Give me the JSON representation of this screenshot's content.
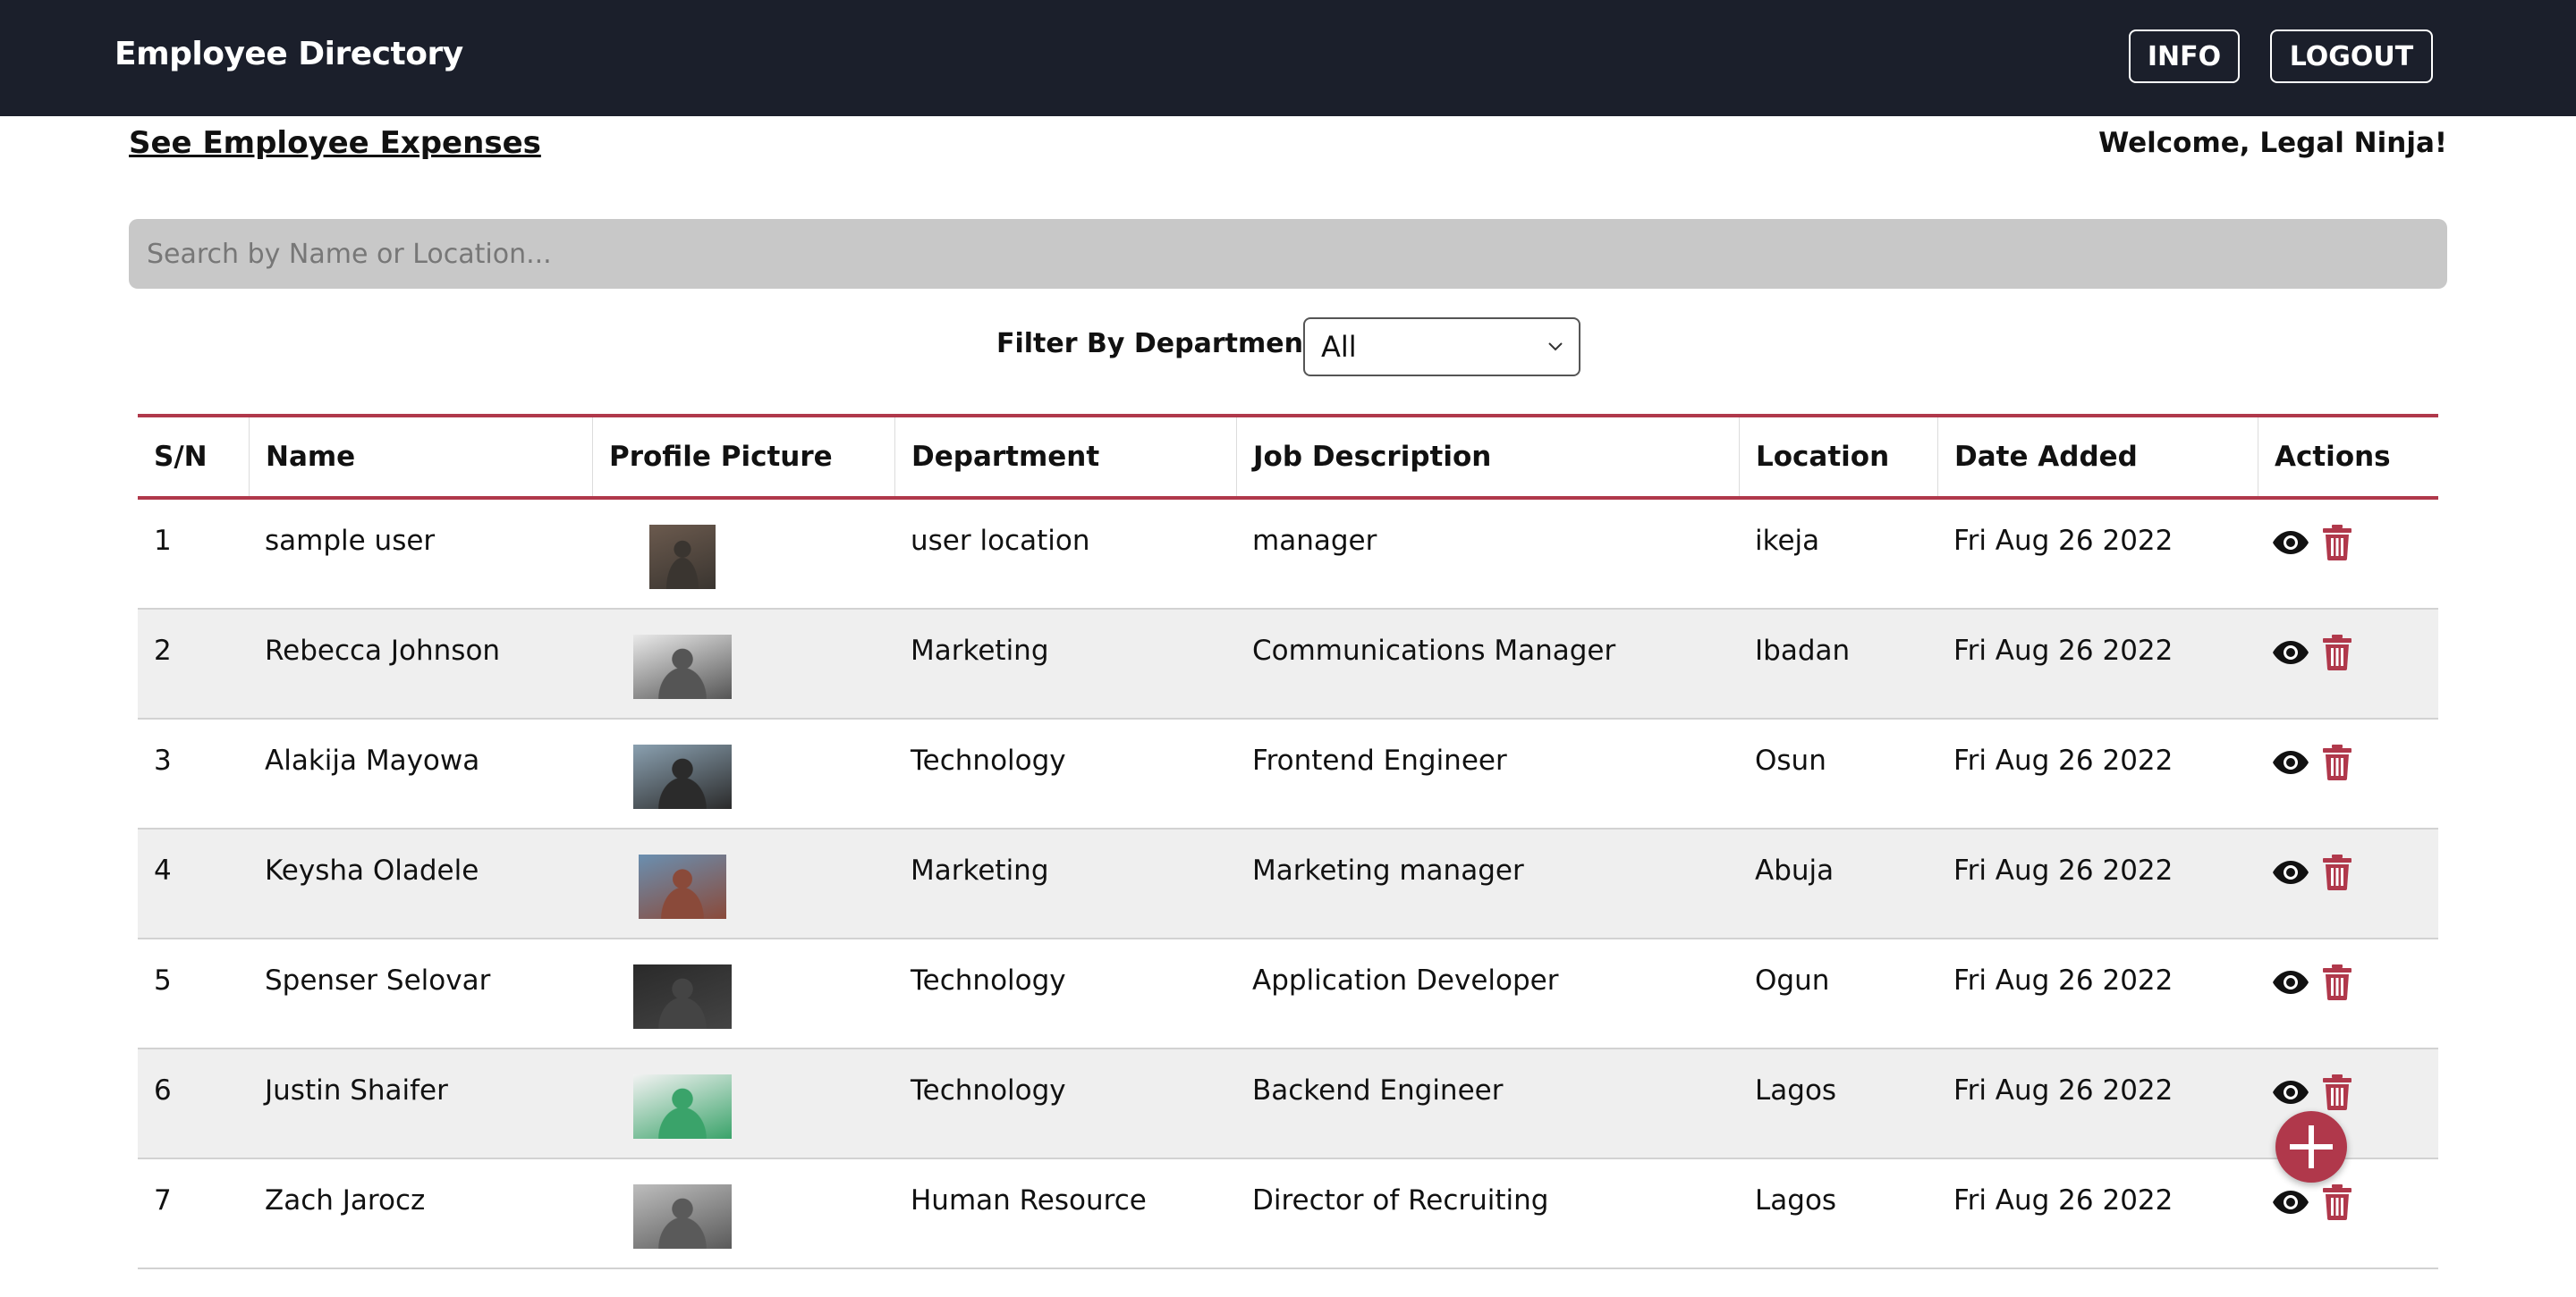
{
  "header": {
    "title": "Employee Directory",
    "info_label": "INFO",
    "logout_label": "LOGOUT"
  },
  "subheader": {
    "expenses_link": "See Employee Expenses",
    "welcome": "Welcome, Legal Ninja!"
  },
  "search": {
    "placeholder": "Search by Name or Location...",
    "value": ""
  },
  "filter": {
    "label": "Filter By Department:",
    "selected": "All"
  },
  "table": {
    "columns": [
      "S/N",
      "Name",
      "Profile Picture",
      "Department",
      "Job Description",
      "Location",
      "Date Added",
      "Actions"
    ],
    "rows": [
      {
        "sn": "1",
        "name": "sample user",
        "department": "user location",
        "job": "manager",
        "location": "ikeja",
        "date": "Fri Aug 26 2022"
      },
      {
        "sn": "2",
        "name": "Rebecca Johnson",
        "department": "Marketing",
        "job": "Communications Manager",
        "location": "Ibadan",
        "date": "Fri Aug 26 2022"
      },
      {
        "sn": "3",
        "name": "Alakija Mayowa",
        "department": "Technology",
        "job": "Frontend Engineer",
        "location": "Osun",
        "date": "Fri Aug 26 2022"
      },
      {
        "sn": "4",
        "name": "Keysha Oladele",
        "department": "Marketing",
        "job": "Marketing manager",
        "location": "Abuja",
        "date": "Fri Aug 26 2022"
      },
      {
        "sn": "5",
        "name": "Spenser Selovar",
        "department": "Technology",
        "job": "Application Developer",
        "location": "Ogun",
        "date": "Fri Aug 26 2022"
      },
      {
        "sn": "6",
        "name": "Justin Shaifer",
        "department": "Technology",
        "job": "Backend Engineer",
        "location": "Lagos",
        "date": "Fri Aug 26 2022"
      },
      {
        "sn": "7",
        "name": "Zach Jarocz",
        "department": "Human Resource",
        "job": "Director of Recruiting",
        "location": "Lagos",
        "date": "Fri Aug 26 2022"
      }
    ]
  },
  "icons": {
    "view": "eye-icon",
    "delete": "trash-icon",
    "add": "plus-icon"
  },
  "colors": {
    "navbar": "#1b1f2b",
    "accent": "#b0384b",
    "search_bg": "#c8c8c8",
    "row_alt": "#efefef"
  }
}
